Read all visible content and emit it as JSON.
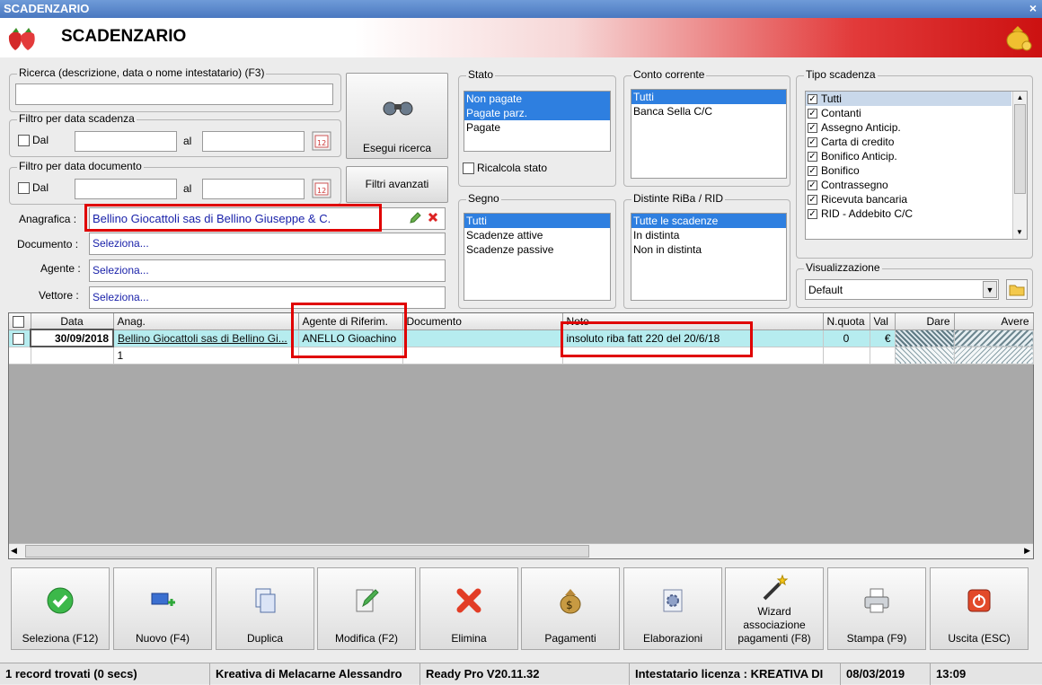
{
  "window": {
    "title": "SCADENZARIO",
    "close": "×"
  },
  "header": {
    "title": "SCADENZARIO"
  },
  "search": {
    "label": "Ricerca (descrizione, data o nome intestatario) (F3)",
    "value": ""
  },
  "filter_scad": {
    "label": "Filtro per data scadenza",
    "dal": "Dal",
    "al": "al"
  },
  "filter_doc": {
    "label": "Filtro per data documento",
    "dal": "Dal",
    "al": "al"
  },
  "buttons": {
    "esegui": "Esegui ricerca",
    "filtri": "Filtri avanzati"
  },
  "fields": {
    "anagrafica_label": "Anagrafica :",
    "anagrafica_value": "Bellino Giocattoli sas di Bellino Giuseppe & C.",
    "documento_label": "Documento :",
    "documento_value": "Seleziona...",
    "agente_label": "Agente :",
    "agente_value": "Seleziona...",
    "vettore_label": "Vettore :",
    "vettore_value": "Seleziona..."
  },
  "stato": {
    "label": "Stato",
    "items": [
      "Non pagate",
      "Pagate parz.",
      "Pagate"
    ],
    "ricalcola": "Ricalcola stato"
  },
  "segno": {
    "label": "Segno",
    "items": [
      "Tutti",
      "Scadenze attive",
      "Scadenze passive"
    ]
  },
  "conto": {
    "label": "Conto corrente",
    "items": [
      "Tutti",
      "Banca Sella C/C"
    ]
  },
  "distinte": {
    "label": "Distinte RiBa / RID",
    "items": [
      "Tutte le scadenze",
      "In distinta",
      "Non in distinta"
    ]
  },
  "tipo": {
    "label": "Tipo scadenza",
    "items": [
      "Tutti",
      "Contanti",
      "Assegno Anticip.",
      "Carta di credito",
      "Bonifico Anticip.",
      "Bonifico",
      "Contrassegno",
      "Ricevuta bancaria",
      "RID - Addebito C/C"
    ]
  },
  "visualizzazione": {
    "label": "Visualizzazione",
    "value": "Default"
  },
  "grid": {
    "columns": [
      "Data",
      "Anag.",
      "Agente di Riferim.",
      "Documento",
      "Note",
      "N.quota",
      "Val",
      "Dare",
      "Avere"
    ],
    "row1": {
      "data": "30/09/2018",
      "anag": "Bellino Giocattoli sas di Bellino Gi...",
      "agente": "ANELLO Gioachino",
      "documento": "",
      "note": "insoluto riba fatt 220 del 20/6/18",
      "nquota": "0",
      "val": "€"
    },
    "row2": {
      "anag": "1"
    }
  },
  "toolbar": [
    {
      "label": "Seleziona (F12)",
      "icon": "check-icon"
    },
    {
      "label": "Nuovo (F4)",
      "icon": "new-icon"
    },
    {
      "label": "Duplica",
      "icon": "duplicate-icon"
    },
    {
      "label": "Modifica (F2)",
      "icon": "edit-icon"
    },
    {
      "label": "Elimina",
      "icon": "delete-icon"
    },
    {
      "label": "Pagamenti",
      "icon": "money-bag-icon"
    },
    {
      "label": "Elaborazioni",
      "icon": "gear-icon"
    },
    {
      "label": "Wizard associazione pagamenti (F8)",
      "icon": "wand-icon"
    },
    {
      "label": "Stampa (F9)",
      "icon": "printer-icon"
    },
    {
      "label": "Uscita (ESC)",
      "icon": "exit-icon"
    }
  ],
  "status": {
    "records": "1 record trovati (0 secs)",
    "company": "Kreativa di Melacarne Alessandro",
    "version": "Ready Pro V20.11.32",
    "license": "Intestatario licenza : KREATIVA DI",
    "date": "08/03/2019",
    "time": "13:09"
  }
}
